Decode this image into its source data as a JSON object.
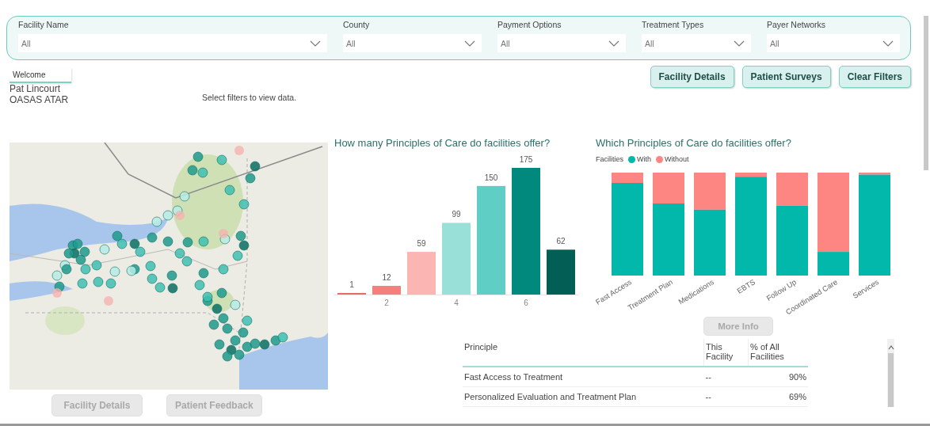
{
  "filters": [
    {
      "label": "Facility Name",
      "value": "All"
    },
    {
      "label": "County",
      "value": "All"
    },
    {
      "label": "Payment Options",
      "value": "All"
    },
    {
      "label": "Treatment Types",
      "value": "All"
    },
    {
      "label": "Payer Networks",
      "value": "All"
    }
  ],
  "welcome": {
    "label": "Welcome",
    "user_name": "Pat Lincourt",
    "organization": "OASAS ATAR"
  },
  "prompt": "Select filters to view data.",
  "header_buttons": [
    {
      "label": "Facility Details",
      "disabled": false
    },
    {
      "label": "Patient Surveys",
      "disabled": false
    },
    {
      "label": "Clear Filters",
      "disabled": false
    }
  ],
  "map_buttons": [
    {
      "label": "Facility Details",
      "disabled": true
    },
    {
      "label": "Patient Feedback",
      "disabled": true
    }
  ],
  "count_chart": {
    "chart_data": {
      "type": "bar",
      "title": "How many Principles of Care do facilities offer?",
      "x": [
        1,
        2,
        3,
        4,
        5,
        6,
        7
      ],
      "values": [
        1,
        12,
        59,
        99,
        150,
        175,
        62
      ],
      "xlim": [
        0.5,
        7.5
      ],
      "xticks": [
        2,
        4,
        6
      ],
      "data_labels": true
    }
  },
  "composition_chart": {
    "title": "Which Principles of Care do facilities offer?",
    "legend": {
      "label": "Facilities",
      "items": [
        {
          "name": "With",
          "color": "#01b8aa"
        },
        {
          "name": "Without",
          "color": "#fd8582"
        }
      ]
    },
    "categories": [
      "Fast Access",
      "Treatment Plan",
      "Medications",
      "EBTS",
      "Follow Up",
      "Coordinated Care",
      "Services"
    ]
  },
  "more_info_button": {
    "label": "More Info",
    "disabled": true
  },
  "table": {
    "columns": [
      "Principle",
      "This Facility",
      "% of All Facilities"
    ],
    "rows": [
      [
        "Fast Access to Treatment",
        "--",
        "90%"
      ],
      [
        "Personalized Evaluation and Treatment Plan",
        "--",
        "69%"
      ]
    ]
  }
}
